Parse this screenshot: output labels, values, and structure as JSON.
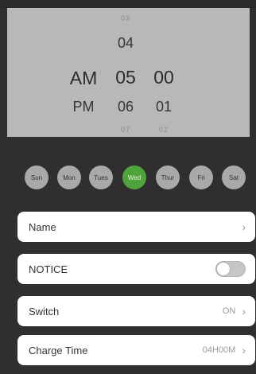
{
  "picker": {
    "ampm": {
      "main_upper": "AM",
      "main_lower": "PM"
    },
    "hour": {
      "faint_top": "03",
      "upper": "04",
      "selected": "05",
      "lower": "06",
      "faint_bottom": "07"
    },
    "minute": {
      "selected": "00",
      "lower": "01",
      "faint_bottom": "02"
    }
  },
  "days": {
    "items": [
      {
        "label": "Sun",
        "active": false
      },
      {
        "label": "Mon",
        "active": false
      },
      {
        "label": "Tues",
        "active": false
      },
      {
        "label": "Wed",
        "active": true
      },
      {
        "label": "Thur",
        "active": false
      },
      {
        "label": "Fri",
        "active": false
      },
      {
        "label": "Sat",
        "active": false
      }
    ],
    "active_color": "#4fa33b",
    "inactive_color": "#a9a9a9"
  },
  "settings": {
    "name": {
      "label": "Name",
      "chevron_icon": "chevron-right-icon"
    },
    "notice": {
      "label": "NOTICE",
      "toggle_on": false
    },
    "switch": {
      "label": "Switch",
      "value": "ON"
    },
    "charge_time": {
      "label": "Charge Time",
      "value": "04H00M"
    }
  }
}
